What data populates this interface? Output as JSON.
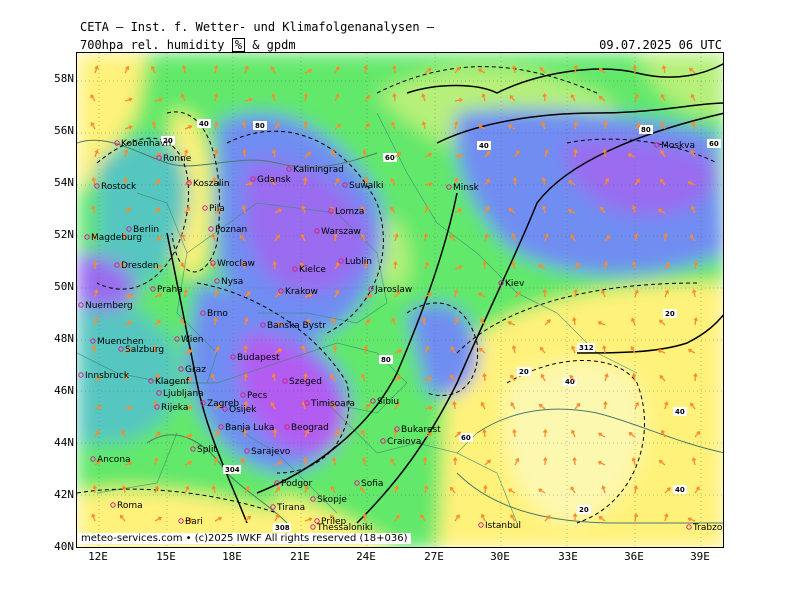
{
  "header": {
    "title": "CETA – Inst. f. Wetter- und Klimafolgenanalysen –",
    "variable_prefix": "700hpa rel. humidity",
    "unit": "%",
    "variable_suffix": "& gpdm",
    "valid_time": "09.07.2025 06 UTC"
  },
  "axes": {
    "latitudes": [
      "58N",
      "56N",
      "54N",
      "52N",
      "50N",
      "48N",
      "46N",
      "44N",
      "42N",
      "40N"
    ],
    "longitudes": [
      "12E",
      "15E",
      "18E",
      "21E",
      "24E",
      "27E",
      "30E",
      "33E",
      "36E",
      "39E"
    ]
  },
  "contour_labels": [
    "20",
    "40",
    "60",
    "80",
    "308",
    "312",
    "304"
  ],
  "cities": [
    "Kobenhavn",
    "Ronne",
    "Rostock",
    "Koszalin",
    "Gdansk",
    "Kaliningrad",
    "Suwalki",
    "Minsk",
    "Moskva",
    "Berlin",
    "Magdeburg",
    "Pila",
    "Poznan",
    "Lomza",
    "Warszaw",
    "Lublin",
    "Dresden",
    "Wroclaw",
    "Nysa",
    "Kielce",
    "Praha",
    "Krakow",
    "Jaroslaw",
    "Kiev",
    "Nuernberg",
    "Brno",
    "Banska Bystr",
    "Muenchen",
    "Salzburg",
    "Wien",
    "Innsbruck",
    "Budapest",
    "Szeged",
    "Graz",
    "Klagenf",
    "Ljubljana",
    "Zagreb",
    "Rijeka",
    "Osijek",
    "Pecs",
    "Timisoara",
    "Sibiu",
    "Banja Luka",
    "Beograd",
    "Craiova",
    "Bukarest",
    "Split",
    "Sarajevo",
    "Ancona",
    "Podgor",
    "Sofia",
    "Skopje",
    "Roma",
    "Bari",
    "Tirana",
    "Prilep",
    "Thessaloniki",
    "Istanbul",
    "Trabzon"
  ],
  "footer": "meteo-services.com • (c)2025 IWKF All rights reserved (18+036)",
  "colors": {
    "dry_yellow": "#fff27a",
    "light_yellow": "#fdf8b0",
    "light_green": "#b6f07a",
    "green": "#62e86a",
    "teal": "#56c6c0",
    "light_blue": "#6f8df2",
    "purple_blue": "#9a6cf0",
    "violet": "#b35cf2",
    "wind_arrow": "#ff8a2a",
    "city_dot": "#d0208a"
  },
  "map_features": {
    "contours": "dashed humidity isolines, solid geopotential isolines",
    "wind_arrows": "orange"
  }
}
